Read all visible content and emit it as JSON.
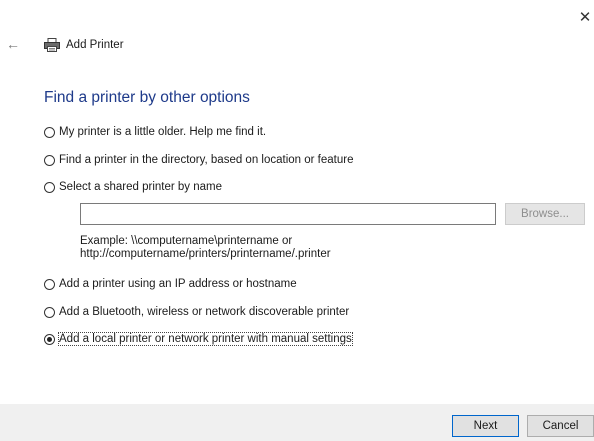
{
  "window": {
    "close_glyph": "✕",
    "back_glyph": "←"
  },
  "header": {
    "title": "Add Printer",
    "icon": "printer-icon"
  },
  "heading": "Find a printer by other options",
  "options": [
    {
      "label": "My printer is a little older. Help me find it.",
      "checked": false
    },
    {
      "label": "Find a printer in the directory, based on location or feature",
      "checked": false
    },
    {
      "label": "Select a shared printer by name",
      "checked": false
    },
    {
      "label": "Add a printer using an IP address or hostname",
      "checked": false
    },
    {
      "label": "Add a Bluetooth, wireless or network discoverable printer",
      "checked": false
    },
    {
      "label": "Add a local printer or network printer with manual settings",
      "checked": true
    }
  ],
  "shared_printer": {
    "value": "",
    "browse_label": "Browse...",
    "example_line1": "Example: \\\\computername\\printername or",
    "example_line2": "http://computername/printers/printername/.printer"
  },
  "footer": {
    "next_label": "Next",
    "cancel_label": "Cancel"
  },
  "colors": {
    "heading": "#1e3a8a",
    "default_button_border": "#0066cc",
    "footer_bg": "#f0f0f0"
  }
}
